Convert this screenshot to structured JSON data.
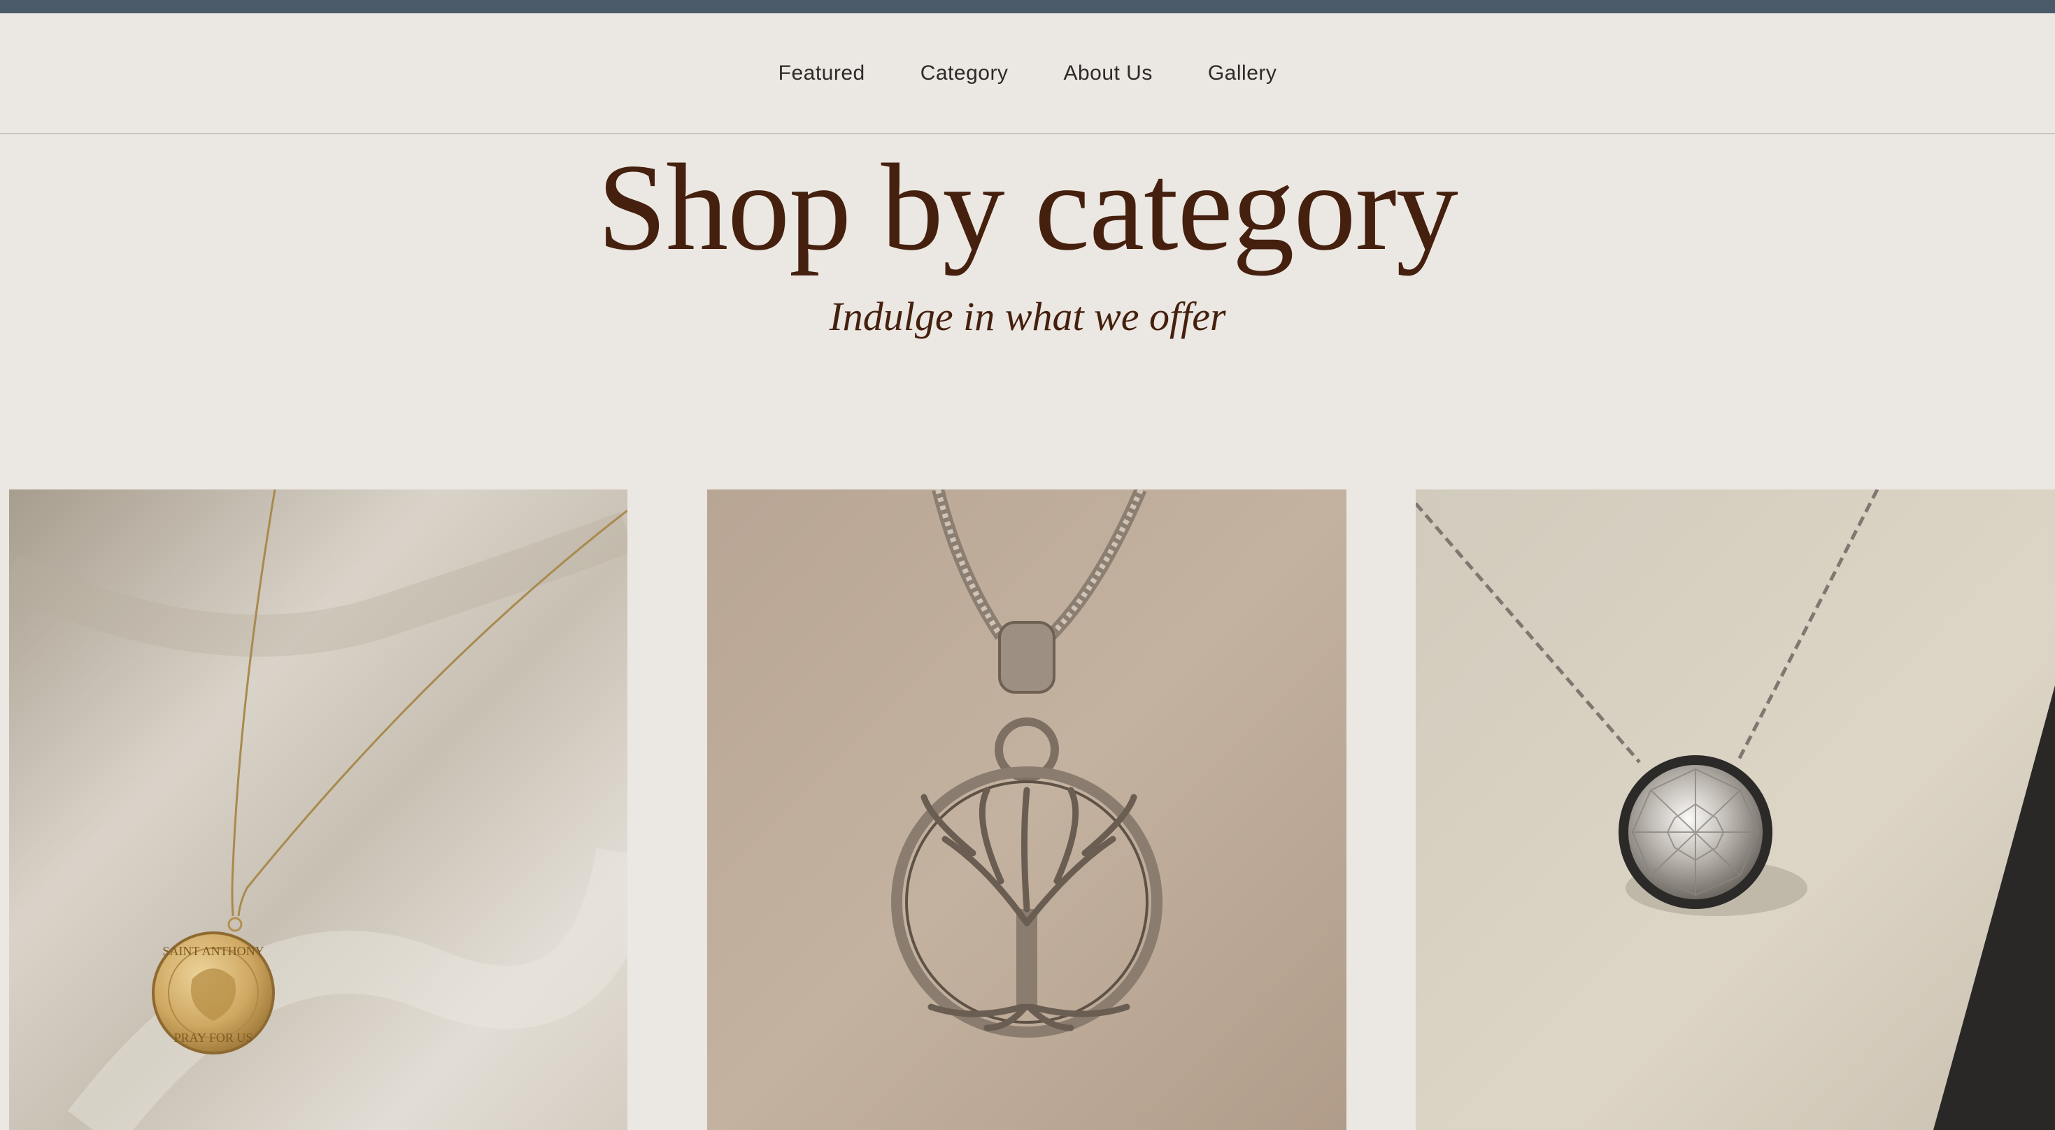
{
  "nav": {
    "items": [
      {
        "label": "Featured"
      },
      {
        "label": "Category"
      },
      {
        "label": "About Us"
      },
      {
        "label": "Gallery"
      }
    ]
  },
  "hero": {
    "title": "Shop by category",
    "subtitle": "Indulge in what we offer"
  },
  "categories": {
    "cards": [
      {
        "image": "gold-medal-necklace-photo",
        "medal_text_top": "SAINT ANTHONY",
        "medal_text_bottom": "PRAY FOR US"
      },
      {
        "image": "silver-tree-of-life-pendant-photo"
      },
      {
        "image": "diamond-solitaire-necklace-photo"
      }
    ]
  },
  "colors": {
    "topbar": "#4a5a68",
    "page_background": "#ebe7e2",
    "title_text": "#45200e",
    "nav_text": "#2f2a27"
  }
}
